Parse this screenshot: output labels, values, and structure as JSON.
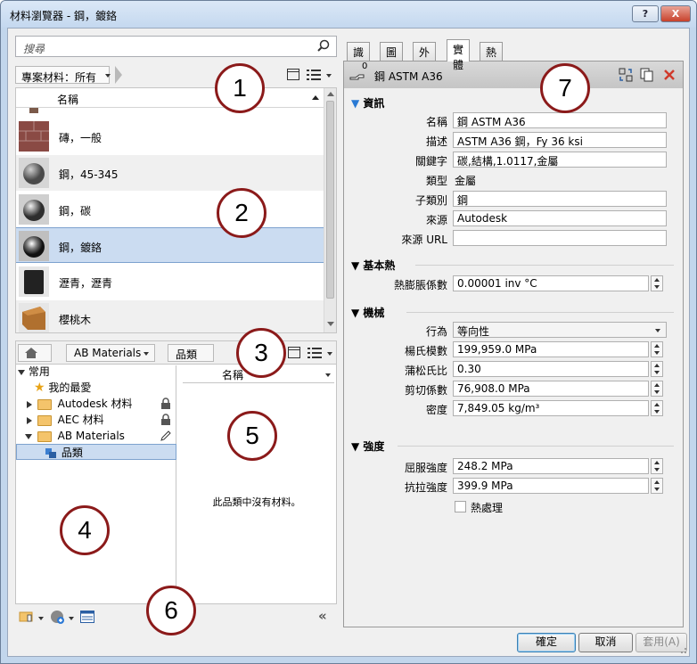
{
  "window": {
    "title": "材料瀏覽器 - 鋼，鍍鉻",
    "help_label": "?",
    "close_label": "X"
  },
  "search": {
    "placeholder": "搜尋"
  },
  "project_materials": {
    "filter_label": "專案材料：所有",
    "column_name": "名稱",
    "rows": [
      {
        "label": "",
        "thumb": "brick-partial"
      },
      {
        "label": "磚，一般",
        "thumb": "brick"
      },
      {
        "label": "鋼，45-345",
        "thumb": "steel-sphere"
      },
      {
        "label": "鋼，碳",
        "thumb": "carbon-steel-sphere"
      },
      {
        "label": "鋼，鍍鉻",
        "thumb": "chrome-sphere",
        "selected": true
      },
      {
        "label": "瀝青，瀝青",
        "thumb": "asphalt"
      },
      {
        "label": "櫻桃木",
        "thumb": "cherry-wood"
      }
    ]
  },
  "library": {
    "breadcrumb": [
      "AB Materials",
      "品類"
    ],
    "tree": [
      {
        "label": "常用",
        "level": 0,
        "expander": "down"
      },
      {
        "label": "我的最愛",
        "level": 1,
        "icon": "star"
      },
      {
        "label": "Autodesk 材料",
        "level": 1,
        "expander": "right",
        "icon": "folder",
        "badge": "lock"
      },
      {
        "label": "AEC 材料",
        "level": 1,
        "expander": "right",
        "icon": "folder",
        "badge": "lock"
      },
      {
        "label": "AB Materials",
        "level": 1,
        "expander": "down",
        "icon": "folder",
        "badge": "pencil"
      },
      {
        "label": "品類",
        "level": 2,
        "icon": "category",
        "selected": true
      }
    ],
    "column_name": "名稱",
    "empty_message": "此品類中沒有材料。"
  },
  "editor": {
    "tabs": [
      "識別",
      "圖形",
      "外觀",
      "實體",
      "熱度"
    ],
    "active_tab": "實體",
    "asset_name": "鋼 ASTM A36",
    "asset_count": "0",
    "sections": {
      "info": {
        "title": "資訊",
        "name_label": "名稱",
        "name_value": "鋼 ASTM A36",
        "desc_label": "描述",
        "desc_value": "ASTM A36 鋼，Fy 36 ksi",
        "keywords_label": "關鍵字",
        "keywords_value": "碳,結構,1.0117,金屬",
        "type_label": "類型",
        "type_value": "金屬",
        "subclass_label": "子類別",
        "subclass_value": "鋼",
        "source_label": "來源",
        "source_value": "Autodesk",
        "source_url_label": "來源 URL",
        "source_url_value": ""
      },
      "thermal": {
        "title": "基本熱",
        "expansion_label": "熱膨脹係數",
        "expansion_value": "0.00001 inv °C"
      },
      "mechanical": {
        "title": "機械",
        "behavior_label": "行為",
        "behavior_value": "等向性",
        "youngs_label": "楊氏模數",
        "youngs_value": "199,959.0 MPa",
        "poisson_label": "蒲松氏比",
        "poisson_value": "0.30",
        "shear_label": "剪切係數",
        "shear_value": "76,908.0 MPa",
        "density_label": "密度",
        "density_value": "7,849.05 kg/m³"
      },
      "strength": {
        "title": "強度",
        "yield_label": "屈服強度",
        "yield_value": "248.2 MPa",
        "tensile_label": "抗拉強度",
        "tensile_value": "399.9 MPa",
        "heat_treated_label": "熱處理",
        "heat_treated": false
      }
    }
  },
  "buttons": {
    "ok": "確定",
    "cancel": "取消",
    "apply": "套用(A)"
  },
  "callouts": [
    "1",
    "2",
    "3",
    "4",
    "5",
    "6",
    "7"
  ],
  "colors": {
    "selection": "#cbdcf1",
    "callout_border": "#8b1a1a",
    "title_bar": "#c4d8ef"
  }
}
